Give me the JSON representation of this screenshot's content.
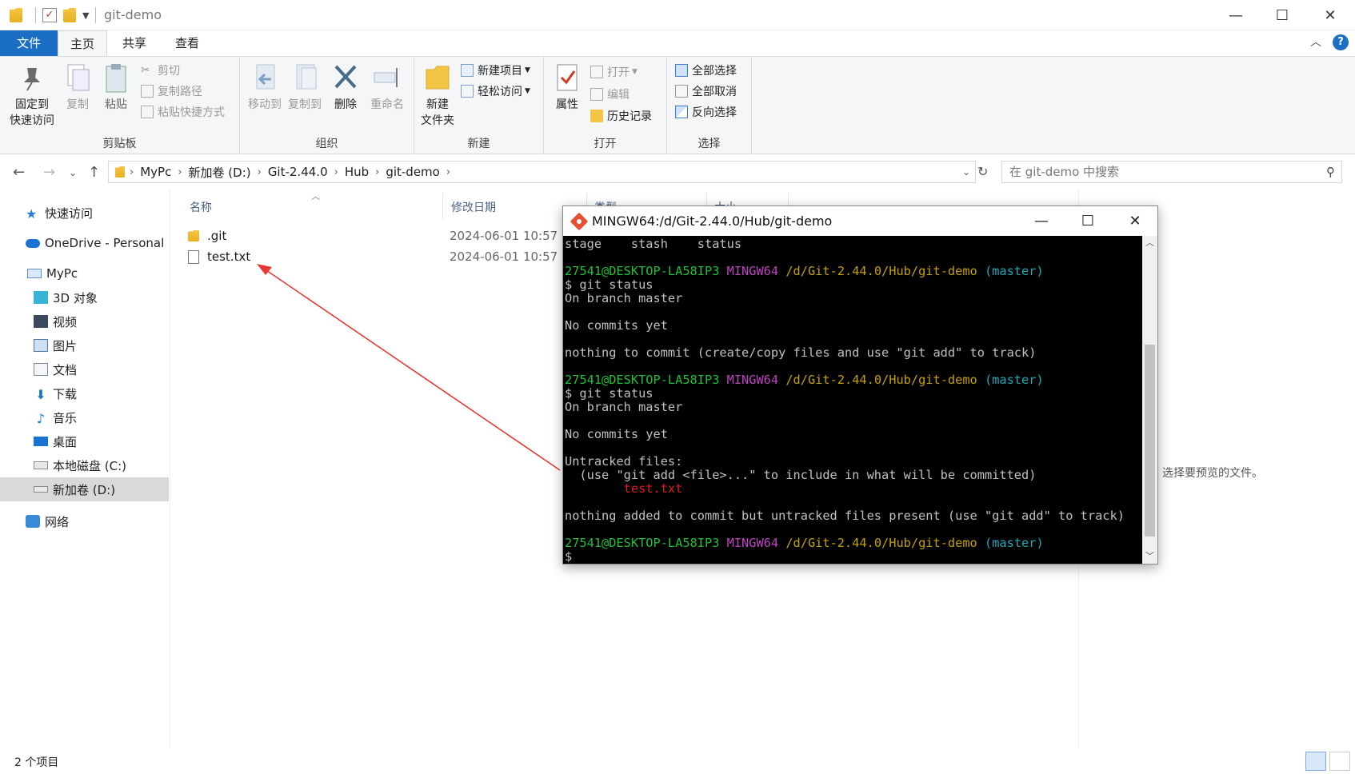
{
  "window": {
    "title": "git-demo"
  },
  "tabs": {
    "file": "文件",
    "home": "主页",
    "share": "共享",
    "view": "查看"
  },
  "ribbon": {
    "clipboard": {
      "label": "剪贴板",
      "pin_line1": "固定到",
      "pin_line2": "快速访问",
      "copy": "复制",
      "paste": "粘贴",
      "cut": "剪切",
      "copy_path": "复制路径",
      "paste_shortcut": "粘贴快捷方式"
    },
    "organize": {
      "label": "组织",
      "move_to": "移动到",
      "copy_to": "复制到",
      "delete": "删除",
      "rename": "重命名"
    },
    "new": {
      "label": "新建",
      "new_folder_line1": "新建",
      "new_folder_line2": "文件夹",
      "new_item": "新建项目",
      "easy_access": "轻松访问"
    },
    "open": {
      "label": "打开",
      "properties": "属性",
      "open": "打开",
      "edit": "编辑",
      "history": "历史记录"
    },
    "select": {
      "label": "选择",
      "select_all": "全部选择",
      "select_none": "全部取消",
      "invert": "反向选择"
    }
  },
  "address": {
    "crumbs": [
      "MyPc",
      "新加卷 (D:)",
      "Git-2.44.0",
      "Hub",
      "git-demo"
    ]
  },
  "search": {
    "placeholder": "在 git-demo 中搜索"
  },
  "navpane": {
    "quick_access": "快速访问",
    "onedrive": "OneDrive - Personal",
    "mypc": "MyPc",
    "items": [
      "3D 对象",
      "视频",
      "图片",
      "文档",
      "下载",
      "音乐",
      "桌面",
      "本地磁盘 (C:)",
      "新加卷 (D:)"
    ],
    "network": "网络"
  },
  "filelist": {
    "columns": {
      "name": "名称",
      "date": "修改日期",
      "type": "类型",
      "size": "大小"
    },
    "rows": [
      {
        "name": ".git",
        "date": "2024-06-01 10:57"
      },
      {
        "name": "test.txt",
        "date": "2024-06-01 10:57"
      }
    ]
  },
  "preview": {
    "text": "选择要预览的文件。"
  },
  "status": {
    "count": "2 个项目"
  },
  "terminal": {
    "title": "MINGW64:/d/Git-2.44.0/Hub/git-demo",
    "prompt_user": "27541@DESKTOP-LA58IP3",
    "prompt_env": "MINGW64",
    "prompt_path": "/d/Git-2.44.0/Hub/git-demo",
    "prompt_branch": "(master)",
    "top_line": "stage    stash    status",
    "cmd": "$ git status",
    "on_branch": "On branch master",
    "no_commits": "No commits yet",
    "nothing_to_commit": "nothing to commit (create/copy files and use \"git add\" to track)",
    "untracked_header": "Untracked files:",
    "untracked_hint": "  (use \"git add <file>...\" to include in what will be committed)",
    "untracked_file": "        test.txt",
    "nothing_added": "nothing added to commit but untracked files present (use \"git add\" to track)",
    "cursor": "$"
  }
}
